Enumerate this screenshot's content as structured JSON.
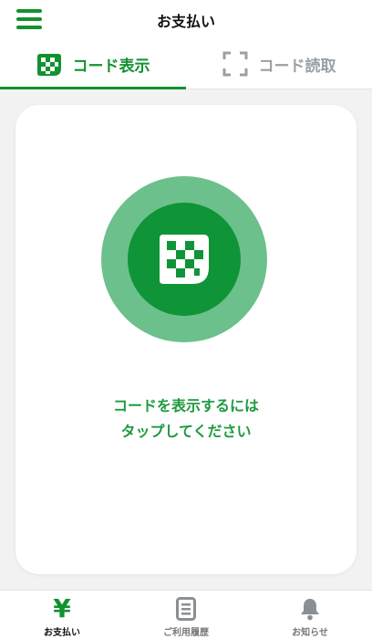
{
  "header": {
    "title": "お支払い",
    "menu_icon": "hamburger-menu-icon"
  },
  "tabs": [
    {
      "label": "コード表示",
      "icon": "qr-code-icon",
      "active": true
    },
    {
      "label": "コード読取",
      "icon": "scan-frame-icon",
      "active": false
    }
  ],
  "card": {
    "button_icon": "qr-code-icon",
    "prompt_line1": "コードを表示するには",
    "prompt_line2": "タップしてください"
  },
  "bottom_nav": [
    {
      "label": "お支払い",
      "icon": "yen-icon",
      "active": true
    },
    {
      "label": "ご利用履歴",
      "icon": "history-document-icon",
      "active": false
    },
    {
      "label": "お知らせ",
      "icon": "bell-icon",
      "active": false
    }
  ],
  "colors": {
    "accent": "#12922f",
    "circle_outer": "#6cc08b",
    "circle_inner": "#0f9438",
    "inactive": "#9aa0a6",
    "background": "#f2f2f2"
  }
}
